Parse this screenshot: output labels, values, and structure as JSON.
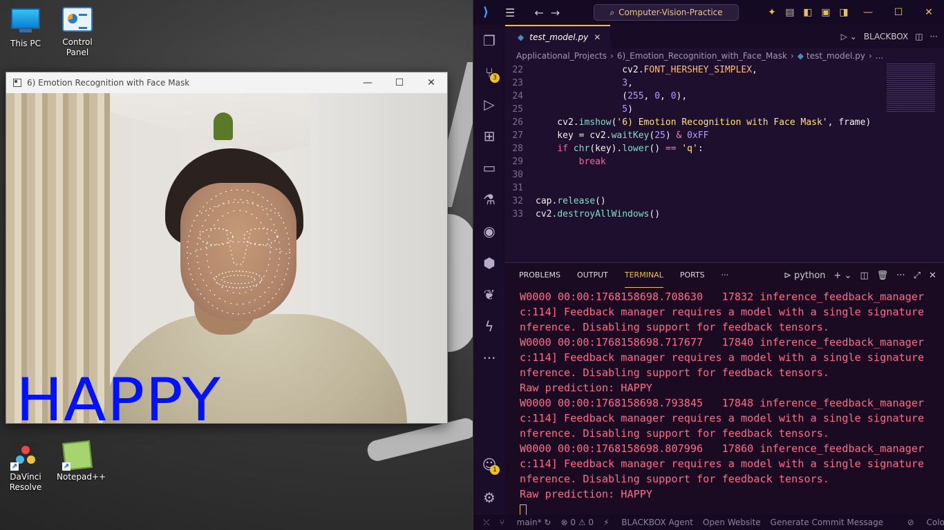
{
  "desktop": {
    "icons": [
      {
        "label": "This PC"
      },
      {
        "label": "Control Panel"
      },
      {
        "label": "DaVinci Resolve"
      },
      {
        "label": "Notepad++"
      }
    ]
  },
  "cam_window": {
    "title": "6) Emotion Recognition with Face Mask",
    "minimize": "—",
    "maximize": "☐",
    "close": "✕",
    "emotion_label": "HAPPY",
    "emotion_color": "#0011ff"
  },
  "vscode": {
    "search": "Computer-Vision-Practice",
    "tab": {
      "name": "test_model.py",
      "close": "✕"
    },
    "blackbox": "BLACKBOX",
    "breadcrumb": [
      "Applicational_Projects",
      "6)_Emotion_Recognition_with_Face_Mask",
      "test_model.py",
      "..."
    ],
    "source_control_badge": "3",
    "accounts_badge": "1",
    "code_lines": [
      {
        "n": "22",
        "text": "                cv2.FONT_HERSHEY_SIMPLEX,"
      },
      {
        "n": "23",
        "text": "                3,"
      },
      {
        "n": "24",
        "text": "                (255, 0, 0),"
      },
      {
        "n": "25",
        "text": "                5)"
      },
      {
        "n": "26",
        "text": "    cv2.imshow('6) Emotion Recognition with Face Mask', frame)"
      },
      {
        "n": "27",
        "text": "    key = cv2.waitKey(25) & 0xFF"
      },
      {
        "n": "28",
        "text": "    if chr(key).lower() == 'q':"
      },
      {
        "n": "29",
        "text": "        break"
      },
      {
        "n": "30",
        "text": ""
      },
      {
        "n": "31",
        "text": ""
      },
      {
        "n": "32",
        "text": "cap.release()"
      },
      {
        "n": "33",
        "text": "cv2.destroyAllWindows()"
      }
    ],
    "panel_tabs": [
      "PROBLEMS",
      "OUTPUT",
      "TERMINAL",
      "PORTS",
      "···"
    ],
    "terminal_shell": "python",
    "terminal_lines": [
      "W0000 00:00:1768158698.708630   17832 inference_feedback_manager.c",
      "c:114] Feedback manager requires a model with a single signature i",
      "nference. Disabling support for feedback tensors.",
      "W0000 00:00:1768158698.717677   17840 inference_feedback_manager.c",
      "c:114] Feedback manager requires a model with a single signature i",
      "nference. Disabling support for feedback tensors.",
      "Raw prediction: HAPPY",
      "W0000 00:00:1768158698.793845   17848 inference_feedback_manager.c",
      "c:114] Feedback manager requires a model with a single signature i",
      "nference. Disabling support for feedback tensors.",
      "W0000 00:00:1768158698.807996   17860 inference_feedback_manager.c",
      "c:114] Feedback manager requires a model with a single signature i",
      "nference. Disabling support for feedback tensors.",
      "Raw prediction: HAPPY"
    ],
    "status": {
      "branch": "main*",
      "errors": "⊗ 0 ⚠ 0",
      "agent": "BLACKBOX Agent",
      "open_website": "Open Website",
      "commit": "Generate Commit Message",
      "colors": "Colo"
    }
  }
}
